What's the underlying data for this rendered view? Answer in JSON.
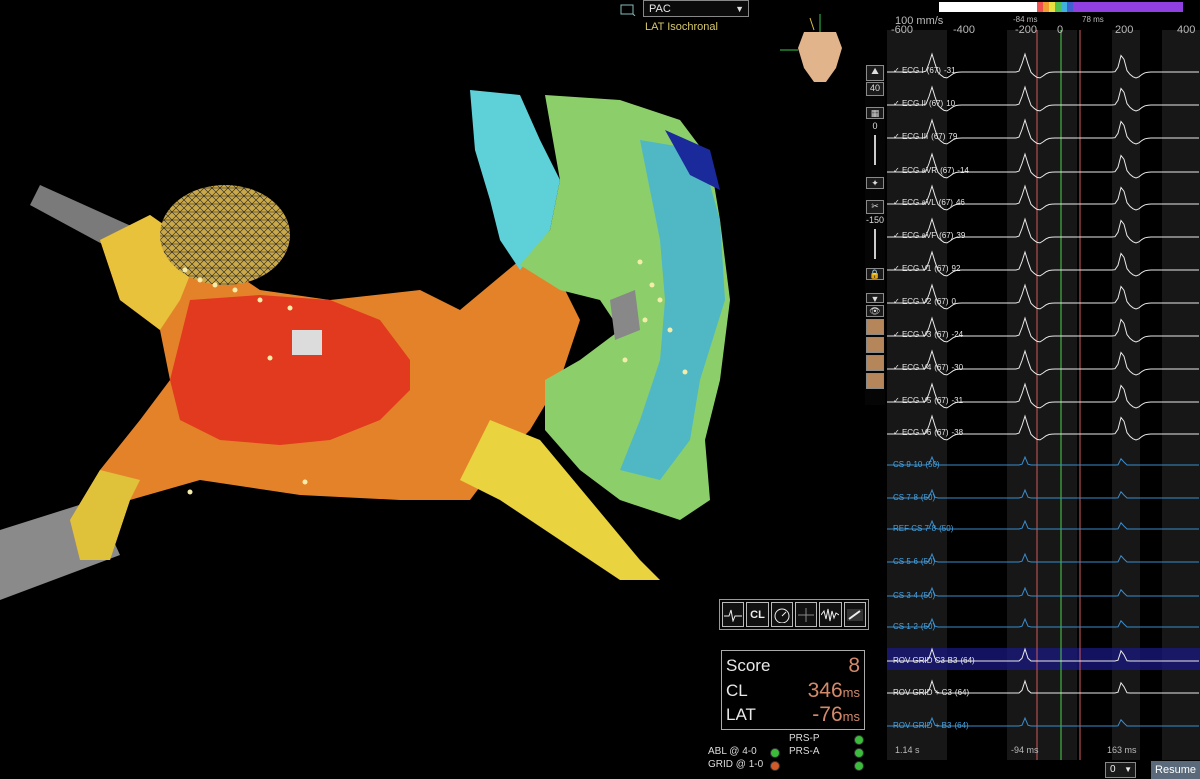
{
  "map": {
    "dropdown_value": "PAC",
    "mode_label": "LAT Isochronal"
  },
  "toolbar": {
    "buttons": [
      "ecg-tool-icon",
      "CL",
      "gauge-icon",
      "move-icon",
      "waveform-icon",
      "catheter-icon"
    ],
    "cl_label": "CL"
  },
  "score": {
    "score_label": "Score",
    "score_value": "8",
    "cl_label": "CL",
    "cl_value": "346",
    "cl_unit": "ms",
    "lat_label": "LAT",
    "lat_value": "-76",
    "lat_unit": "ms"
  },
  "status": {
    "prs_p": "PRS-P",
    "prs_a": "PRS-A",
    "abl": "ABL @ 4-0",
    "grid": "GRID @ 1-0",
    "colors": {
      "green": "#3bbd3b",
      "red": "#d05a2a"
    }
  },
  "sidebar": {
    "zoom_value": "40",
    "gain_value": "0",
    "offset_value": "-150"
  },
  "egm": {
    "sweep_speed": "100 mm/s",
    "ticks": [
      "-600",
      "-400",
      "-200",
      "0",
      "200",
      "400"
    ],
    "window_left": "-84 ms",
    "window_right": "78 ms",
    "time_left": "1.14 s",
    "marker_left": "-94 ms",
    "marker_right": "163 ms",
    "select_value": "0",
    "resume_label": "Resume",
    "channels": [
      {
        "label": "ECG I",
        "num": "(67)",
        "val": "-31",
        "type": "ecg"
      },
      {
        "label": "ECG II",
        "num": "(67)",
        "val": "10",
        "type": "ecg"
      },
      {
        "label": "ECG III",
        "num": "(67)",
        "val": "79",
        "type": "ecg"
      },
      {
        "label": "ECG aVR",
        "num": "(67)",
        "val": "-14",
        "type": "ecg"
      },
      {
        "label": "ECG aVL",
        "num": "(67)",
        "val": "46",
        "type": "ecg"
      },
      {
        "label": "ECG aVF",
        "num": "(67)",
        "val": "39",
        "type": "ecg"
      },
      {
        "label": "ECG V1",
        "num": "(67)",
        "val": "92",
        "type": "ecg"
      },
      {
        "label": "ECG V2",
        "num": "(67)",
        "val": "0",
        "type": "ecg"
      },
      {
        "label": "ECG V3",
        "num": "(67)",
        "val": "-24",
        "type": "ecg"
      },
      {
        "label": "ECG V4",
        "num": "(67)",
        "val": "-30",
        "type": "ecg"
      },
      {
        "label": "ECG V5",
        "num": "(67)",
        "val": "-31",
        "type": "ecg"
      },
      {
        "label": "ECG V6",
        "num": "(67)",
        "val": "-38",
        "type": "ecg"
      },
      {
        "label": "CS 9-10",
        "num": "(50)",
        "val": "",
        "type": "cs"
      },
      {
        "label": "CS 7-8",
        "num": "(50)",
        "val": "",
        "type": "cs"
      },
      {
        "label": "REF CS 7-8",
        "num": "(50)",
        "val": "",
        "type": "cs"
      },
      {
        "label": "CS 5-6",
        "num": "(50)",
        "val": "",
        "type": "cs"
      },
      {
        "label": "CS 3-4",
        "num": "(50)",
        "val": "",
        "type": "cs"
      },
      {
        "label": "CS 1-2",
        "num": "(50)",
        "val": "",
        "type": "cs"
      },
      {
        "label": "ROV GRID C3-B3",
        "num": "(64)",
        "val": "",
        "type": "rov"
      },
      {
        "label": "ROV GRID + C3",
        "num": "(64)",
        "val": "",
        "type": "rov"
      },
      {
        "label": "ROV GRID + B3",
        "num": "(64)",
        "val": "",
        "type": "cs"
      }
    ]
  }
}
